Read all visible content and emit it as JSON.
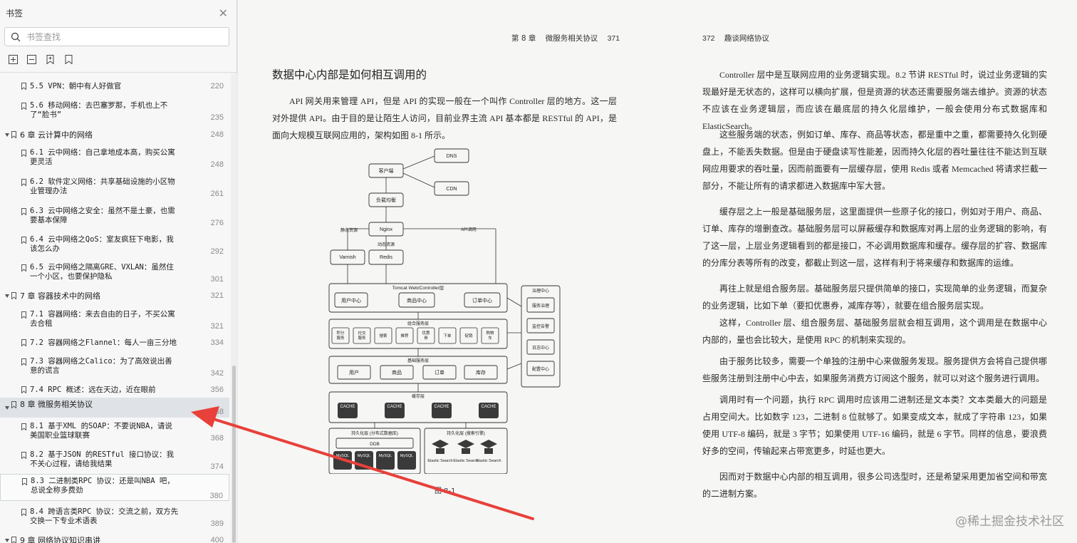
{
  "sidebar": {
    "title": "书签",
    "search_placeholder": "书签查找",
    "items": [
      {
        "title": "5.5 VPN：朝中有人好做官",
        "page": "220"
      },
      {
        "title": "5.6 移动网络：去巴塞罗那，手机也上不了“脸书”",
        "page": "235"
      },
      {
        "title": "6 章  云计算中的网络 ",
        "page": "248"
      },
      {
        "title": "6.1 云中网络：自己拿地成本高，购买公寓更灵活",
        "page": "248"
      },
      {
        "title": "6.2 软件定义网络：共享基础设施的小区物业管理办法",
        "page": "261"
      },
      {
        "title": "6.3 云中网络之安全：虽然不是土豪，也需要基本保障",
        "page": "276"
      },
      {
        "title": "6.4 云中网络之QoS：室友疯狂下电影，我该怎么办 ",
        "page": "292"
      },
      {
        "title": "6.5 云中网络之隔离GRE、VXLAN：虽然住一个小区，也要保护隐私",
        "page": "301"
      },
      {
        "title": "7 章  容器技术中的网络 ",
        "page": "321"
      },
      {
        "title": "7.1 容器网络：来去自由的日子，不买公寓去合租",
        "page": "321"
      },
      {
        "title": "7.2 容器网络之Flannel：每人一亩三分地 ",
        "page": "334"
      },
      {
        "title": "7.3 容器网络之Calico：为了高效说出善意的谎言 ",
        "page": "342"
      },
      {
        "title": "7.4 RPC 概述：远在天边，近在眼前",
        "page": "356"
      },
      {
        "title": "8 章  微服务相关协议 ",
        "page": "368"
      },
      {
        "title": "8.1 基于XML 的SOAP：不要说NBA，请说美国职业篮球联赛 ",
        "page": "368"
      },
      {
        "title": "8.2 基于JSON 的RESTful 接口协议：我不关心过程，请给我结果 ",
        "page": "374"
      },
      {
        "title": "8.3 二进制类RPC 协议：还是叫NBA 吧，总说全称多费劲",
        "page": "380"
      },
      {
        "title": "8.4 跨语言类RPC 协议：交流之前，双方先交换一下专业术语表 ",
        "page": "389"
      },
      {
        "title": "9 章  网络协议知识串讲 ",
        "page": "400"
      }
    ]
  },
  "left_page": {
    "header_chapter": "第 8 章",
    "header_title": "微服务相关协议",
    "header_page": "371",
    "section_title": "数据中心内部是如何相互调用的",
    "paragraph": "API 网关用来管理 API，但是 API 的实现一般在一个叫作 Controller 层的地方。这一层对外提供 API。由于目的是让陌生人访问，目前业界主流 API 基本都是 RESTful 的 API，是面向大规模互联网应用的，架构如图 8-1 所示。",
    "figure_caption": "图 8-1",
    "figure": {
      "dns": "DNS",
      "client": "客户端",
      "cdn": "CDN",
      "lb": "负载均衡",
      "nginx": "Nginx",
      "static": "静态资源",
      "dynamic": "动态资源",
      "api_call": "API调用",
      "varnish": "Varnish",
      "redis": "Redis",
      "tomcat": "Tomcat Web/Controller层",
      "user_center": "用户中心",
      "product_center": "商品中心",
      "order_center": "订单中心",
      "governance": "治理中心",
      "svc_gov": "服务治理",
      "monitor": "监控告警",
      "log_center": "日志中心",
      "config_center": "配置中心",
      "combo_layer": "组合服务层",
      "combo": [
        "积分服务",
        "社交服务",
        "搜索",
        "推荐",
        "优惠券",
        "下单",
        "促销",
        "购物车"
      ],
      "base_layer": "基础服务层",
      "base": [
        "用户",
        "商品",
        "订单",
        "库存"
      ],
      "cache_layer": "缓存层",
      "cache": "CACHE",
      "persist1": "持久化层 (分布式数据库)",
      "ddb": "DDB",
      "mysql": "MySQL",
      "persist2": "持久化层 (搜索引擎)",
      "es": "Elastic Search"
    }
  },
  "right_page": {
    "header_page": "372",
    "header_title": "趣谈网络协议",
    "paragraphs": [
      "Controller 层中是互联网应用的业务逻辑实现。8.2 节讲 RESTful 时，说过业务逻辑的实现最好是无状态的，这样可以横向扩展，但是资源的状态还需要服务端去维护。资源的状态不应该在业务逻辑层，而应该在最底层的持久化层维护，一般会使用分布式数据库和 ElasticSearch。",
      "这些服务端的状态，例如订单、库存、商品等状态，都是重中之重，都需要持久化到硬盘上，不能丢失数据。但是由于硬盘读写性能差，因而持久化层的吞吐量往往不能达到互联网应用要求的吞吐量，因而前面要有一层缓存层，使用 Redis 或者 Memcached 将请求拦截一部分，不能让所有的请求都进入数据库中军大营。",
      "缓存层之上一般是基础服务层，这里面提供一些原子化的接口，例如对于用户、商品、订单、库存的增删查改。基础服务层可以屏蔽缓存和数据库对再上层的业务逻辑的影响，有了这一层，上层业务逻辑看到的都是接口，不必调用数据库和缓存。缓存层的扩容、数据库的分库分表等所有的改变，都截止到这一层，这样有利于将来缓存和数据库的运维。",
      "再往上就是组合服务层。基础服务层只提供简单的接口，实现简单的业务逻辑，而复杂的业务逻辑，比如下单（要扣优惠券，减库存等），就要在组合服务层实现。",
      "这样，Controller 层、组合服务层、基础服务层就会相互调用，这个调用是在数据中心内部的，量也会比较大，是使用 RPC 的机制来实现的。",
      "由于服务比较多，需要一个单独的注册中心来做服务发现。服务提供方会将自己提供哪些服务注册到注册中心中去，如果服务消费方订阅这个服务，就可以对这个服务进行调用。",
      "调用时有一个问题，执行 RPC 调用时应该用二进制还是文本类？文本类最大的问题是占用空间大。比如数字 123，二进制 8 位就够了。如果变成文本，就成了字符串 123，如果使用 UTF-8 编码，就是 3 字节；如果使用 UTF-16 编码，就是 6 字节。同样的信息，要浪费好多的空间，传输起来占带宽更多，时延也更大。",
      "因而对于数据中心内部的相互调用，很多公司选型时，还是希望采用更加省空间和带宽的二进制方案。"
    ]
  },
  "watermark": "@稀土掘金技术社区",
  "colors": {
    "arrow": "#e8403a",
    "sidebar_bg": "#f7f7f7",
    "selected_bg": "#dfe2e6"
  }
}
